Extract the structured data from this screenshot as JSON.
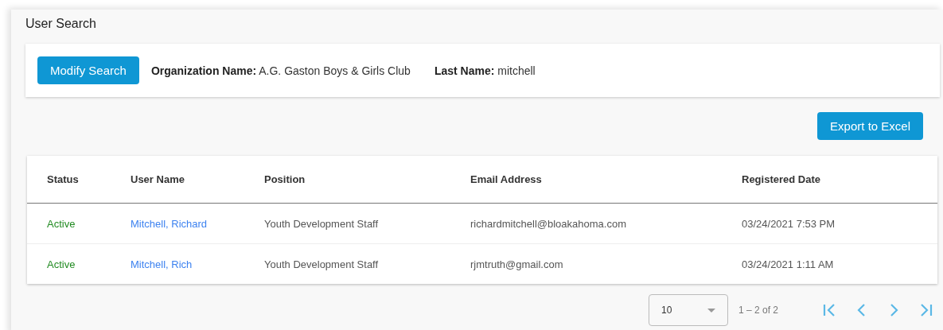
{
  "title": "User Search",
  "modify_button": "Modify Search",
  "filters": [
    {
      "label": "Organization Name:",
      "value": "A.G. Gaston Boys & Girls Club"
    },
    {
      "label": "Last Name:",
      "value": "mitchell"
    }
  ],
  "export_button": "Export to Excel",
  "table": {
    "columns": [
      "Status",
      "User Name",
      "Position",
      "Email Address",
      "Registered Date"
    ],
    "rows": [
      {
        "status": {
          "text": "Active",
          "kind": "active"
        },
        "user_name": "Mitchell, Richard",
        "position": "Youth Development Staff",
        "email": "richardmitchell@bloakahoma.com",
        "registered": "03/24/2021 7:53 PM"
      },
      {
        "status": {
          "text": "Active",
          "kind": "active"
        },
        "user_name": "Mitchell, Rich",
        "position": "Youth Development Staff",
        "email": "rjmtruth@gmail.com",
        "registered": "03/24/2021 1:11 AM"
      }
    ]
  },
  "pager": {
    "page_size": "10",
    "range": "1 – 2 of 2"
  }
}
